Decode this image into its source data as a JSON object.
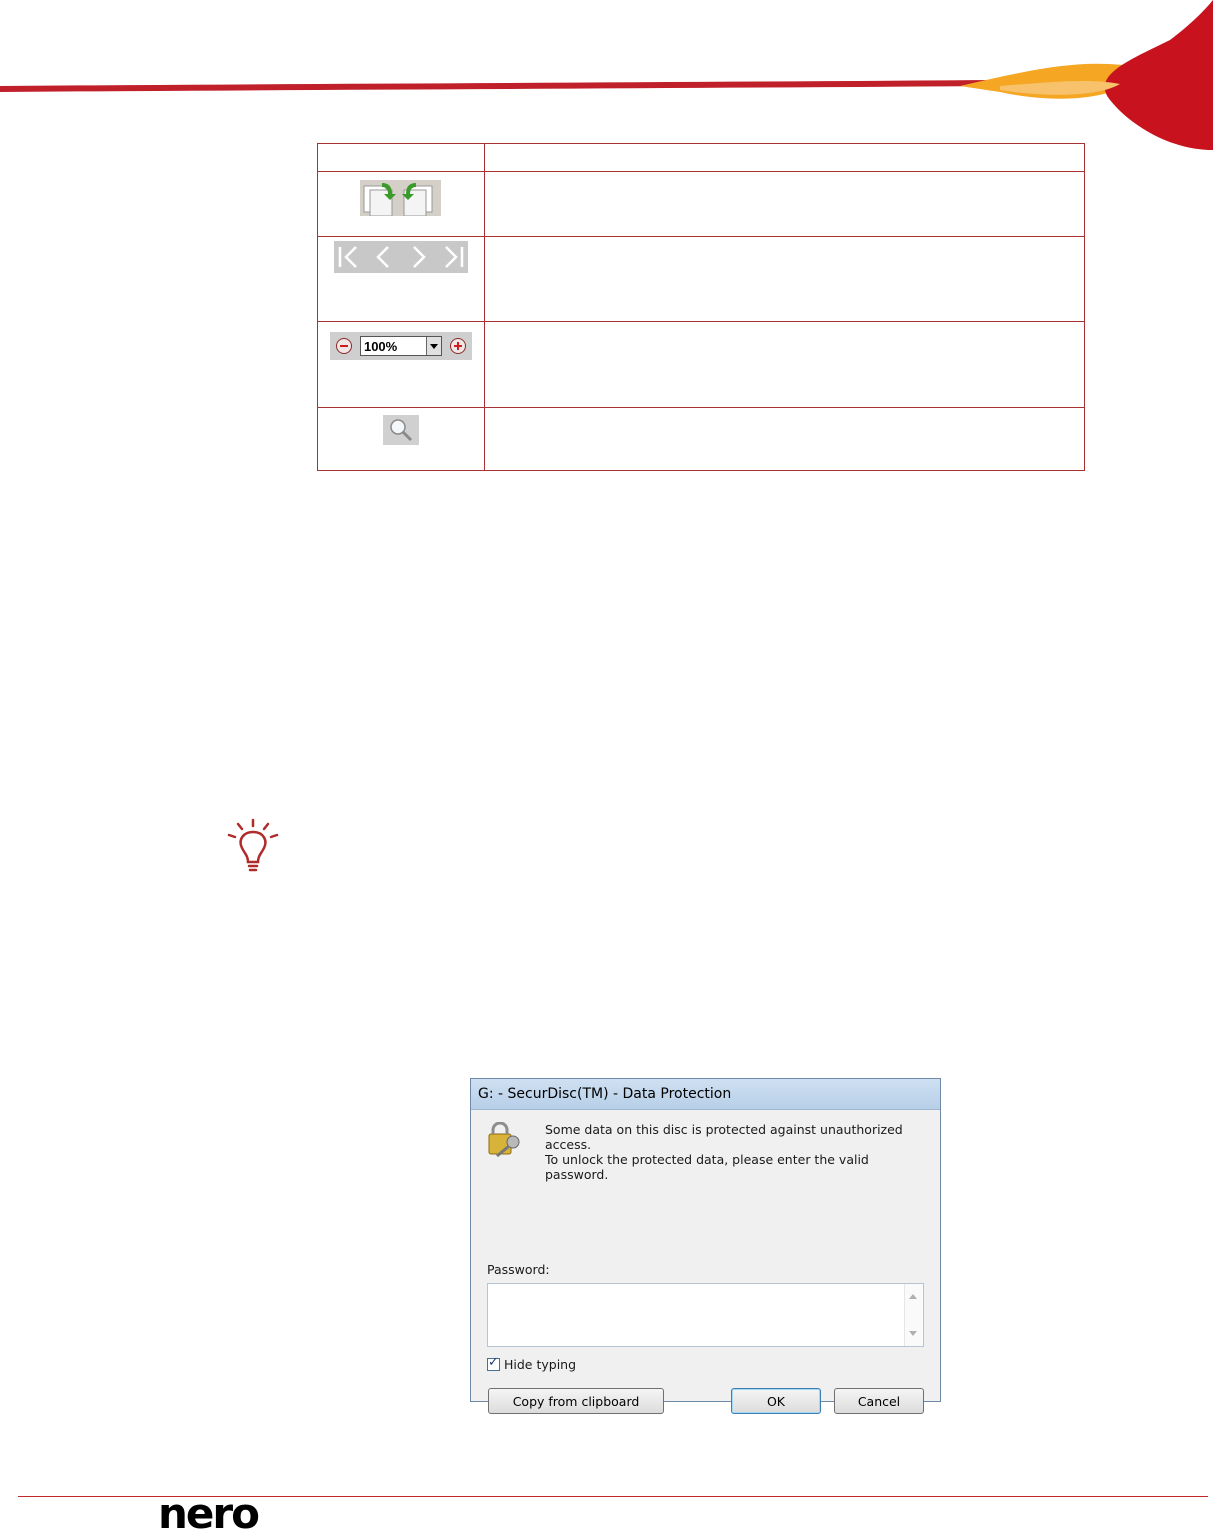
{
  "table": {
    "header": [
      "",
      ""
    ],
    "rows": [
      {
        "icon": "rotate-pages-icon",
        "description": ""
      },
      {
        "icon": "page-navigation-icon",
        "description": ""
      },
      {
        "icon": "zoom-control-icon",
        "zoom_value": "100%",
        "description": ""
      },
      {
        "icon": "magnifier-icon",
        "description": ""
      }
    ]
  },
  "tip": {
    "icon": "lightbulb-icon"
  },
  "dialog": {
    "title": "G: - SecurDisc(TM) - Data Protection",
    "message_line1": "Some data on this disc is protected against unauthorized access.",
    "message_line2": "To unlock the protected data, please enter the valid password.",
    "password_label": "Password:",
    "password_value": "",
    "hide_typing_label": "Hide typing",
    "hide_typing_checked": true,
    "copy_button": "Copy from clipboard",
    "ok_button": "OK",
    "cancel_button": "Cancel"
  },
  "footer": {
    "logo_text": "nero"
  },
  "colors": {
    "accent": "#c0202a",
    "swoosh_orange": "#f5a623",
    "dialog_title": "#cfe0f2"
  }
}
